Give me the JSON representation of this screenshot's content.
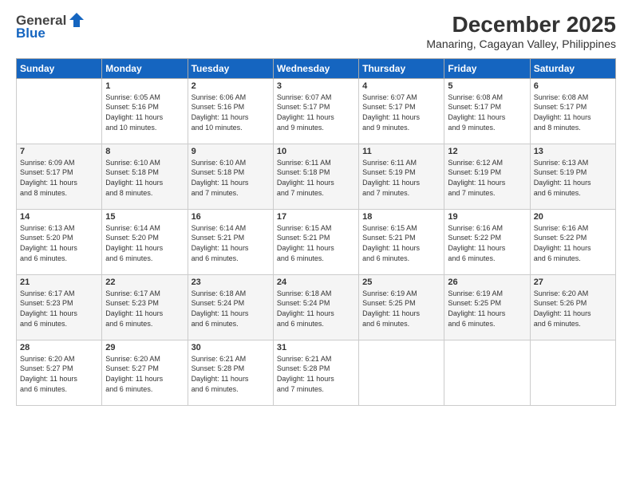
{
  "header": {
    "logo_general": "General",
    "logo_blue": "Blue",
    "month": "December 2025",
    "location": "Manaring, Cagayan Valley, Philippines"
  },
  "weekdays": [
    "Sunday",
    "Monday",
    "Tuesday",
    "Wednesday",
    "Thursday",
    "Friday",
    "Saturday"
  ],
  "weeks": [
    [
      {
        "day": "",
        "info": ""
      },
      {
        "day": "1",
        "info": "Sunrise: 6:05 AM\nSunset: 5:16 PM\nDaylight: 11 hours\nand 10 minutes."
      },
      {
        "day": "2",
        "info": "Sunrise: 6:06 AM\nSunset: 5:16 PM\nDaylight: 11 hours\nand 10 minutes."
      },
      {
        "day": "3",
        "info": "Sunrise: 6:07 AM\nSunset: 5:17 PM\nDaylight: 11 hours\nand 9 minutes."
      },
      {
        "day": "4",
        "info": "Sunrise: 6:07 AM\nSunset: 5:17 PM\nDaylight: 11 hours\nand 9 minutes."
      },
      {
        "day": "5",
        "info": "Sunrise: 6:08 AM\nSunset: 5:17 PM\nDaylight: 11 hours\nand 9 minutes."
      },
      {
        "day": "6",
        "info": "Sunrise: 6:08 AM\nSunset: 5:17 PM\nDaylight: 11 hours\nand 8 minutes."
      }
    ],
    [
      {
        "day": "7",
        "info": "Sunrise: 6:09 AM\nSunset: 5:17 PM\nDaylight: 11 hours\nand 8 minutes."
      },
      {
        "day": "8",
        "info": "Sunrise: 6:10 AM\nSunset: 5:18 PM\nDaylight: 11 hours\nand 8 minutes."
      },
      {
        "day": "9",
        "info": "Sunrise: 6:10 AM\nSunset: 5:18 PM\nDaylight: 11 hours\nand 7 minutes."
      },
      {
        "day": "10",
        "info": "Sunrise: 6:11 AM\nSunset: 5:18 PM\nDaylight: 11 hours\nand 7 minutes."
      },
      {
        "day": "11",
        "info": "Sunrise: 6:11 AM\nSunset: 5:19 PM\nDaylight: 11 hours\nand 7 minutes."
      },
      {
        "day": "12",
        "info": "Sunrise: 6:12 AM\nSunset: 5:19 PM\nDaylight: 11 hours\nand 7 minutes."
      },
      {
        "day": "13",
        "info": "Sunrise: 6:13 AM\nSunset: 5:19 PM\nDaylight: 11 hours\nand 6 minutes."
      }
    ],
    [
      {
        "day": "14",
        "info": "Sunrise: 6:13 AM\nSunset: 5:20 PM\nDaylight: 11 hours\nand 6 minutes."
      },
      {
        "day": "15",
        "info": "Sunrise: 6:14 AM\nSunset: 5:20 PM\nDaylight: 11 hours\nand 6 minutes."
      },
      {
        "day": "16",
        "info": "Sunrise: 6:14 AM\nSunset: 5:21 PM\nDaylight: 11 hours\nand 6 minutes."
      },
      {
        "day": "17",
        "info": "Sunrise: 6:15 AM\nSunset: 5:21 PM\nDaylight: 11 hours\nand 6 minutes."
      },
      {
        "day": "18",
        "info": "Sunrise: 6:15 AM\nSunset: 5:21 PM\nDaylight: 11 hours\nand 6 minutes."
      },
      {
        "day": "19",
        "info": "Sunrise: 6:16 AM\nSunset: 5:22 PM\nDaylight: 11 hours\nand 6 minutes."
      },
      {
        "day": "20",
        "info": "Sunrise: 6:16 AM\nSunset: 5:22 PM\nDaylight: 11 hours\nand 6 minutes."
      }
    ],
    [
      {
        "day": "21",
        "info": "Sunrise: 6:17 AM\nSunset: 5:23 PM\nDaylight: 11 hours\nand 6 minutes."
      },
      {
        "day": "22",
        "info": "Sunrise: 6:17 AM\nSunset: 5:23 PM\nDaylight: 11 hours\nand 6 minutes."
      },
      {
        "day": "23",
        "info": "Sunrise: 6:18 AM\nSunset: 5:24 PM\nDaylight: 11 hours\nand 6 minutes."
      },
      {
        "day": "24",
        "info": "Sunrise: 6:18 AM\nSunset: 5:24 PM\nDaylight: 11 hours\nand 6 minutes."
      },
      {
        "day": "25",
        "info": "Sunrise: 6:19 AM\nSunset: 5:25 PM\nDaylight: 11 hours\nand 6 minutes."
      },
      {
        "day": "26",
        "info": "Sunrise: 6:19 AM\nSunset: 5:25 PM\nDaylight: 11 hours\nand 6 minutes."
      },
      {
        "day": "27",
        "info": "Sunrise: 6:20 AM\nSunset: 5:26 PM\nDaylight: 11 hours\nand 6 minutes."
      }
    ],
    [
      {
        "day": "28",
        "info": "Sunrise: 6:20 AM\nSunset: 5:27 PM\nDaylight: 11 hours\nand 6 minutes."
      },
      {
        "day": "29",
        "info": "Sunrise: 6:20 AM\nSunset: 5:27 PM\nDaylight: 11 hours\nand 6 minutes."
      },
      {
        "day": "30",
        "info": "Sunrise: 6:21 AM\nSunset: 5:28 PM\nDaylight: 11 hours\nand 6 minutes."
      },
      {
        "day": "31",
        "info": "Sunrise: 6:21 AM\nSunset: 5:28 PM\nDaylight: 11 hours\nand 7 minutes."
      },
      {
        "day": "",
        "info": ""
      },
      {
        "day": "",
        "info": ""
      },
      {
        "day": "",
        "info": ""
      }
    ]
  ]
}
